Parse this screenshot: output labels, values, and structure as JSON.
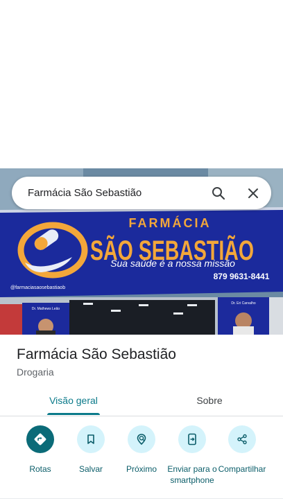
{
  "search": {
    "query": "Farmácia São Sebastião"
  },
  "hero_sign": {
    "top_word": "FARMÁCIA",
    "main_name": "SÃO SEBASTIÃO",
    "slogan": "Sua saúde é a nossa missão",
    "phone": "879 9631-8441",
    "instagram": "@farmaciasaosebastiaob",
    "left_poster_name": "Dr. Mathews Leão",
    "right_poster_name": "Dr. Eri Carvalho"
  },
  "place": {
    "name": "Farmácia São Sebastião",
    "category": "Drogaria"
  },
  "tabs": [
    {
      "label": "Visão geral"
    },
    {
      "label": "Sobre"
    }
  ],
  "actions": [
    {
      "label": "Rotas",
      "icon": "directions-icon"
    },
    {
      "label": "Salvar",
      "icon": "bookmark-icon"
    },
    {
      "label": "Próximo",
      "icon": "nearby-icon"
    },
    {
      "label": "Enviar para o smartphone",
      "icon": "send-to-phone-icon"
    },
    {
      "label": "Compartilhar",
      "icon": "share-icon"
    }
  ],
  "colors": {
    "accent": "#0b7a8a",
    "action_bg": "#d4f3fb",
    "primary_action": "#0b6b78",
    "sign_blue": "#1c2a9c",
    "sign_orange": "#f3a73a"
  }
}
